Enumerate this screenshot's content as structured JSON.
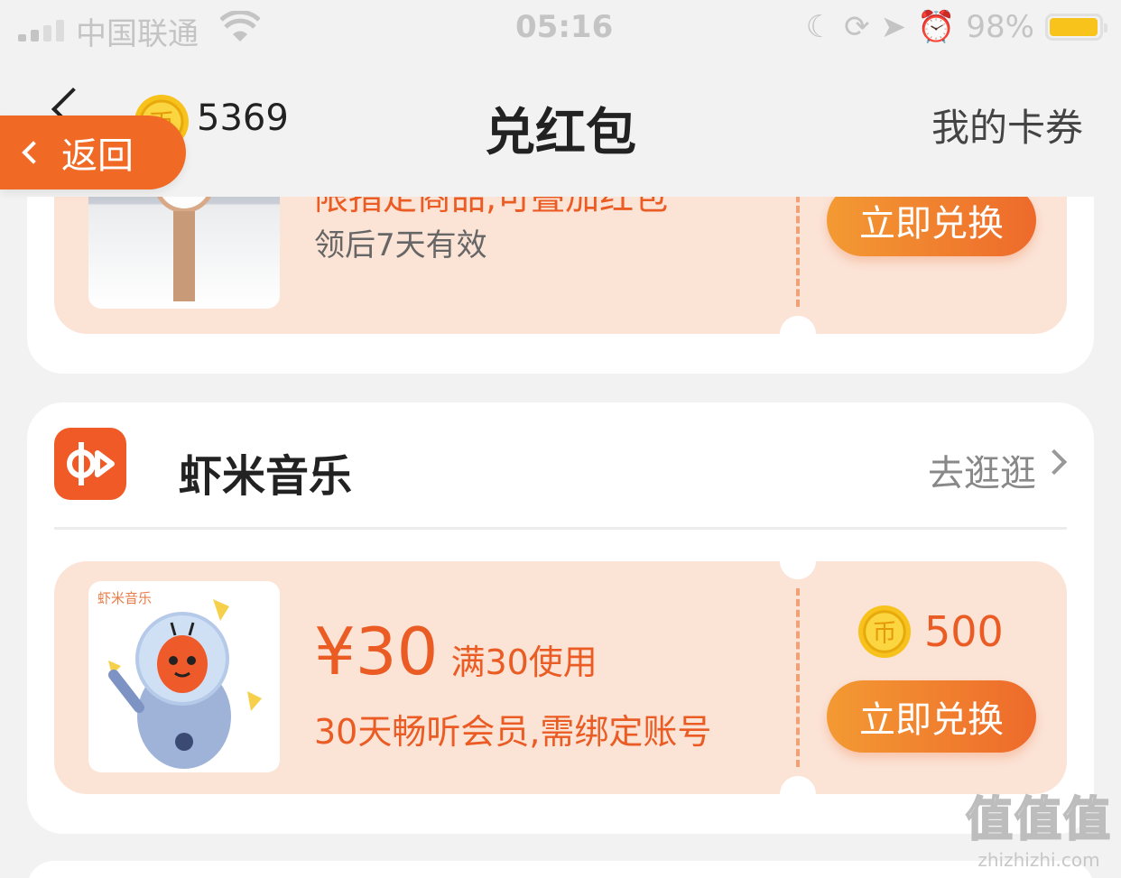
{
  "status_bar": {
    "carrier": "中国联通",
    "time": "05:16",
    "battery": "98%",
    "battery_level": 0.98
  },
  "nav": {
    "coin_count": "5369",
    "title": "兑红包",
    "right_link": "我的卡券",
    "return_label": "返回"
  },
  "top_coupon": {
    "description": "限指定商品,可叠加红包",
    "validity": "领后7天有效",
    "button": "立即兑换"
  },
  "music_section": {
    "brand_name": "虾米音乐",
    "brand_link": "去逛逛",
    "coupon": {
      "image_brand": "虾米音乐",
      "price": "¥30",
      "condition": "满30使用",
      "description": "30天畅听会员,需绑定账号",
      "coin_cost": "500",
      "button": "立即兑换"
    }
  },
  "watermark": {
    "logo": "值值值",
    "url": "zhizhizhi.com"
  },
  "colors": {
    "accent": "#ee6a2b",
    "coupon_bg": "#fbe3d6",
    "coupon_text": "#ea5c24"
  }
}
